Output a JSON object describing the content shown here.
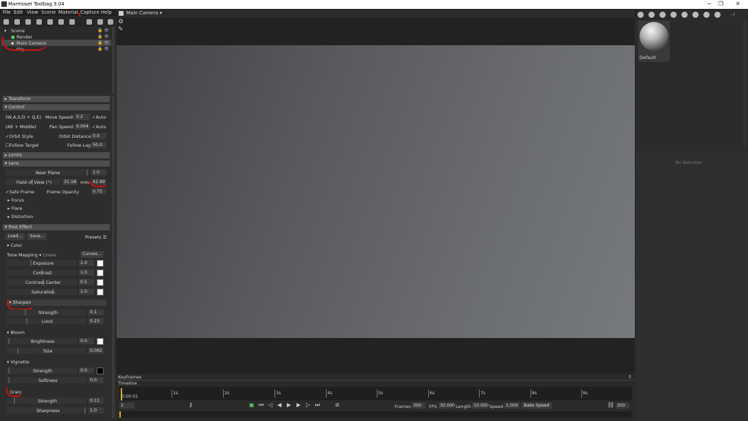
{
  "title_bar": {
    "title": "Marmoset Toolbag 3.04",
    "minimize": "−",
    "maximize": "❐",
    "close": "✕"
  },
  "menu": [
    "File",
    "Edit",
    "View",
    "Scene",
    "Material",
    "Capture",
    "Help"
  ],
  "scene_tree": {
    "items": [
      {
        "label": "Scene"
      },
      {
        "label": "Render"
      },
      {
        "label": "Main Camera"
      },
      {
        "label": "Sky"
      }
    ]
  },
  "sections": {
    "transform": "Transform",
    "control": "Control",
    "limits": "Limits",
    "lens": "Lens",
    "post_effect": "Post Effect"
  },
  "control": {
    "keys_label": "(W,A,S,D + Q,E)",
    "move_speed_label": "Move Speed:",
    "move_speed": "0.2",
    "move_auto": "Auto",
    "alt_label": "(Alt + Middle)",
    "pan_speed_label": "Pan Speed:",
    "pan_speed": "0.004",
    "pan_auto": "Auto",
    "orbit_style": "Orbit Style",
    "orbit_distance_label": "Orbit Distance:",
    "orbit_distance": "0.0",
    "follow_target": "Follow Target",
    "follow_lag_label": "Follow Lag",
    "follow_lag": "50.0"
  },
  "lens": {
    "near_plane_label": "Near Plane",
    "near_plane": "1.0",
    "fov_label": "Field of View (°)",
    "fov": "31.18",
    "mm_label": "mm:",
    "mm": "42.99",
    "safe_frame": "Safe Frame",
    "frame_opacity_label": "Frame Opacity",
    "frame_opacity": "0.75",
    "focus": "Focus",
    "flare": "Flare",
    "distortion": "Distortion"
  },
  "post_effect": {
    "load": "Load...",
    "save": "Save...",
    "presets": "Presets ☰",
    "color": "Color",
    "tone_mapping_label": "Tone Mapping",
    "tone_mapping_value": "Linear",
    "curves": "Curves...",
    "rows_color": [
      {
        "label": "Exposure",
        "value": "1.0"
      },
      {
        "label": "Contrast",
        "value": "1.0"
      },
      {
        "label": "Contrast Center",
        "value": "0.5"
      },
      {
        "label": "Saturation",
        "value": "1.0"
      }
    ],
    "sharpen": "Sharpen",
    "sharpen_strength_label": "Strength",
    "sharpen_strength": "0.1",
    "sharpen_limit_label": "Limit",
    "sharpen_limit": "0.23",
    "bloom": "Bloom",
    "bloom_brightness_label": "Brightness",
    "bloom_brightness": "0.0",
    "bloom_size_label": "Size",
    "bloom_size": "0.062",
    "vignette": "Vignette",
    "vignette_strength_label": "Strength",
    "vignette_strength": "0.0",
    "vignette_softness_label": "Softness",
    "vignette_softness": "0.0",
    "grain": "Grain",
    "grain_strength_label": "Strength",
    "grain_strength": "0.11",
    "grain_sharpness_label": "Sharpness",
    "grain_sharpness": "1.0"
  },
  "viewport": {
    "camera_label": "Main Camera"
  },
  "right_panel": {
    "material_name": "Default",
    "no_selection": "No Selection",
    "page_indicator": "- /"
  },
  "timeline": {
    "keyframes": "Keyframes",
    "timeline": "Timeline",
    "current_time": "0:00.01",
    "ticks": [
      "1s",
      "2s",
      "3s",
      "4s",
      "5s",
      "6s",
      "7s",
      "8s",
      "9s"
    ],
    "frame_field": "1",
    "frames_label": "Frames",
    "frames": "300",
    "fps_label": "FPS",
    "fps": "30.000",
    "length_label": "Length",
    "length": "10.000",
    "speed_label": "Speed",
    "speed": "1.000",
    "bake_speed": "Bake Speed",
    "end_frame": "300"
  }
}
